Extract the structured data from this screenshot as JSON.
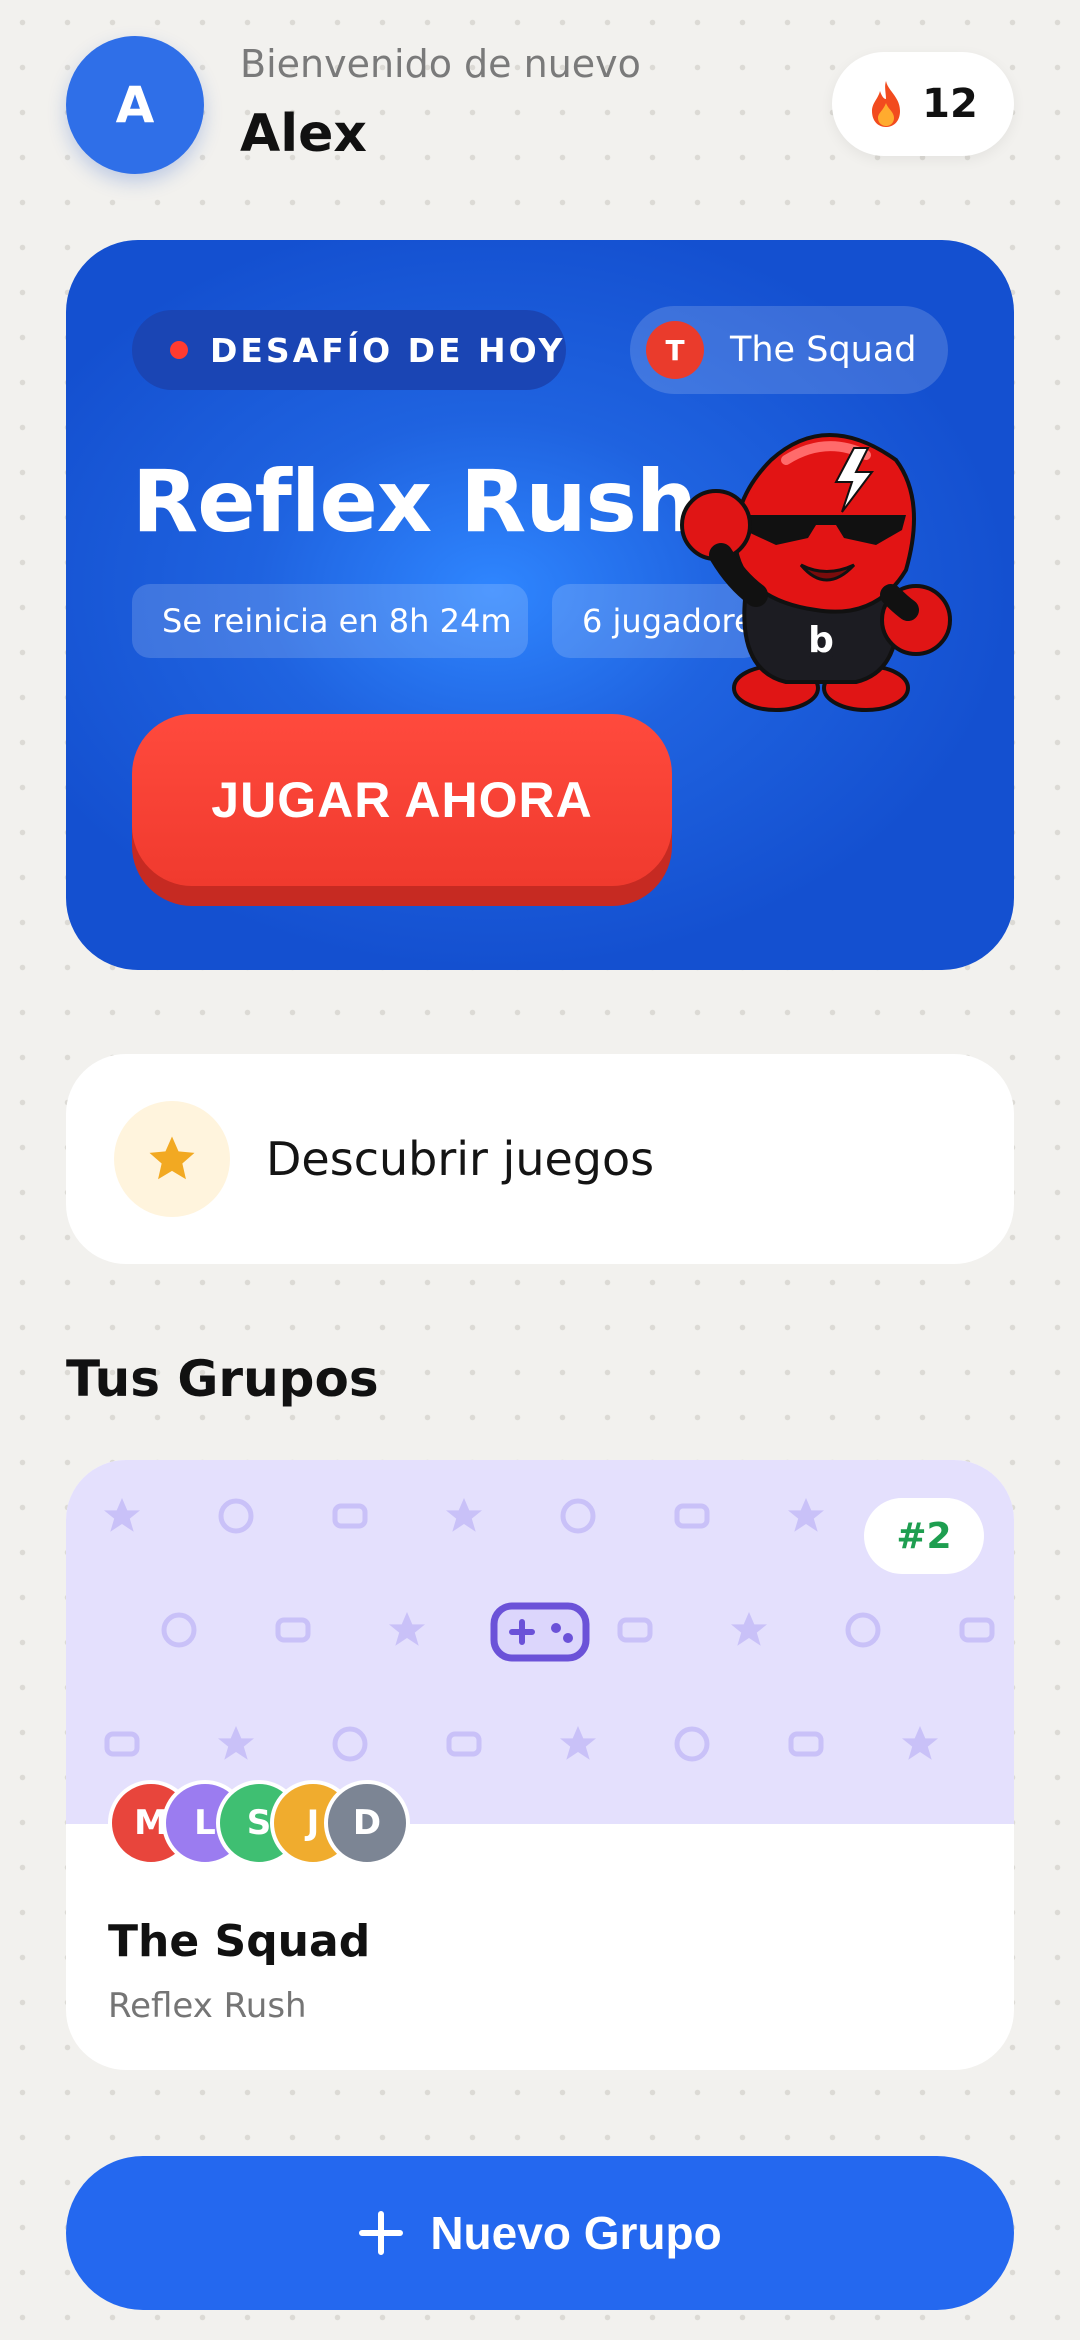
{
  "header": {
    "avatar_initial": "A",
    "welcome_text": "Bienvenido de nuevo",
    "username": "Alex",
    "streak_count": "12"
  },
  "challenge": {
    "badge_label": "DESAFÍO DE HOY",
    "group_initial": "T",
    "group_name": "The Squad",
    "game_title": "Reflex Rush",
    "reset_text": "Se reinicia en 8h 24m",
    "players_text": "6 jugadores",
    "play_button": "JUGAR AHORA",
    "mascot_letter": "b"
  },
  "discover": {
    "label": "Descubrir juegos"
  },
  "groups": {
    "section_title": "Tus Grupos",
    "items": [
      {
        "rank": "#2",
        "name": "The Squad",
        "game": "Reflex Rush",
        "members": [
          {
            "initial": "M",
            "color": "#e8453c"
          },
          {
            "initial": "L",
            "color": "#9b7cf0"
          },
          {
            "initial": "S",
            "color": "#3fbf72"
          },
          {
            "initial": "J",
            "color": "#f0ac2e"
          },
          {
            "initial": "D",
            "color": "#7c8594"
          }
        ]
      }
    ]
  },
  "new_group_button": "Nuevo Grupo",
  "colors": {
    "primary_blue": "#2468ef",
    "play_red": "#f03a2e",
    "rank_green": "#1e9e50",
    "banner_lavender": "#e4e0fd"
  }
}
